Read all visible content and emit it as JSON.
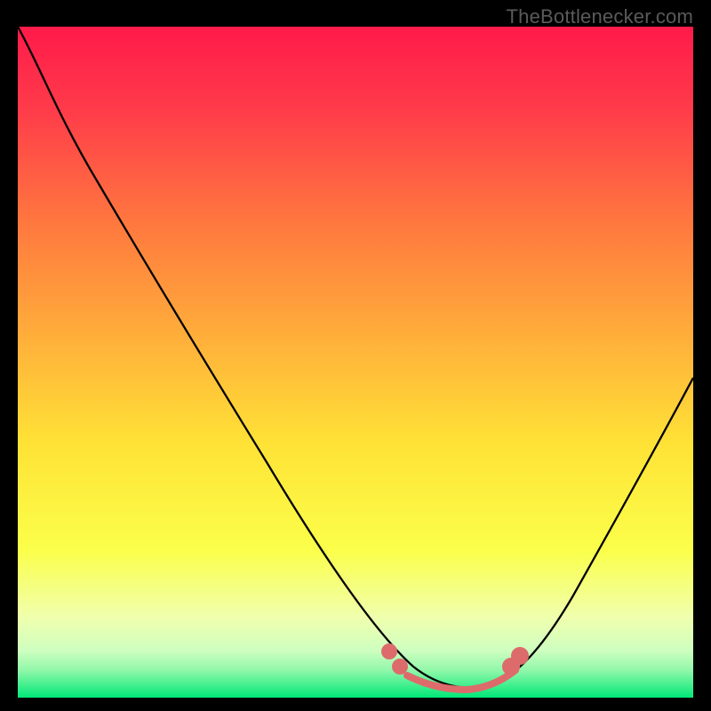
{
  "watermark": "TheBottlenecker.com",
  "chart_data": {
    "type": "line",
    "title": "",
    "xlabel": "",
    "ylabel": "",
    "xlim": [
      0,
      100
    ],
    "ylim": [
      0,
      100
    ],
    "grid": false,
    "background_gradient": {
      "top": "#ff1a4a",
      "mid_upper": "#ff8a3a",
      "mid": "#ffe236",
      "mid_lower": "#f6ff70",
      "near_bottom": "#c8ffb0",
      "bottom": "#00e878"
    },
    "series": [
      {
        "name": "curve",
        "color": "#000000",
        "x": [
          0,
          3,
          7,
          12,
          18,
          25,
          32,
          40,
          48,
          55,
          60,
          63,
          66,
          70,
          75,
          80,
          85,
          90,
          95,
          100
        ],
        "y": [
          100,
          94,
          86,
          77,
          67,
          55,
          44,
          32,
          20,
          10,
          5,
          3,
          2,
          3,
          7,
          13,
          22,
          32,
          42,
          52
        ]
      },
      {
        "name": "highlight-points",
        "color": "#e57373",
        "type": "scatter",
        "x": [
          55,
          57,
          60,
          63,
          66,
          69,
          72,
          74
        ],
        "y": [
          6,
          4,
          3,
          2.5,
          2.5,
          3,
          4,
          6
        ]
      }
    ]
  }
}
